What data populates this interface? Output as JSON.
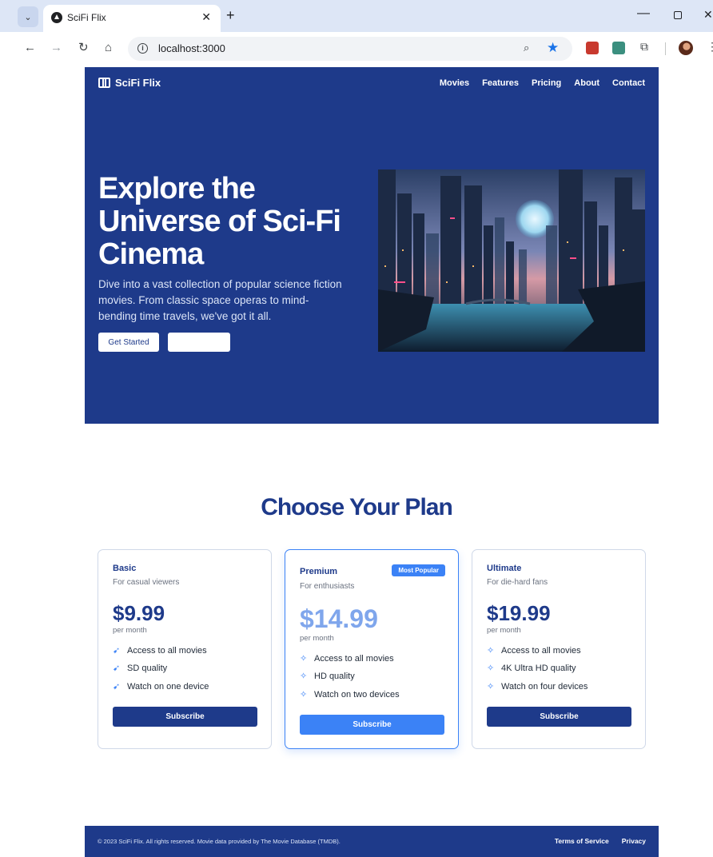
{
  "browser": {
    "tab_title": "SciFi Flix",
    "url": "localhost:3000"
  },
  "site": {
    "brand": "SciFi Flix",
    "nav": [
      "Movies",
      "Features",
      "Pricing",
      "About",
      "Contact"
    ]
  },
  "hero": {
    "title": "Explore the Universe of Sci-Fi Cinema",
    "subtitle": "Dive into a vast collection of popular science fiction movies. From classic space operas to mind-bending time travels, we've got it all.",
    "primary_button": "Get Started"
  },
  "plans": {
    "heading": "Choose Your Plan",
    "items": [
      {
        "name": "Basic",
        "description": "For casual viewers",
        "price": "$9.99",
        "period": "per month",
        "features": [
          "Access to all movies",
          "SD quality",
          "Watch on one device"
        ],
        "button": "Subscribe"
      },
      {
        "name": "Premium",
        "badge": "Most Popular",
        "description": "For enthusiasts",
        "price": "$14.99",
        "period": "per month",
        "features": [
          "Access to all movies",
          "HD quality",
          "Watch on two devices"
        ],
        "button": "Subscribe"
      },
      {
        "name": "Ultimate",
        "description": "For die-hard fans",
        "price": "$19.99",
        "period": "per month",
        "features": [
          "Access to all movies",
          "4K Ultra HD quality",
          "Watch on four devices"
        ],
        "button": "Subscribe"
      }
    ]
  },
  "footer": {
    "copyright": "© 2023 SciFi Flix. All rights reserved. Movie data provided by The Movie Database (TMDB).",
    "links": [
      "Terms of Service",
      "Privacy"
    ]
  },
  "colors": {
    "primary": "#1e3a8a",
    "accent": "#3b82f6"
  },
  "icons": [
    "film-icon",
    "rocket-icon",
    "star-icon",
    "info-icon",
    "zoom-icon",
    "puzzle-icon"
  ]
}
